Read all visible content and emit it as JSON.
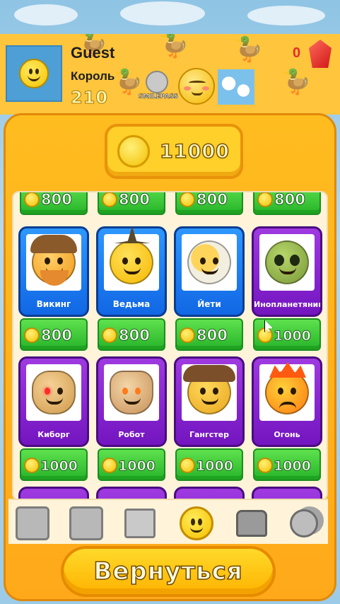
{
  "header": {
    "player_name": "Guest",
    "player_rank": "Король",
    "player_score": "210",
    "gems": "0",
    "smilepass_label": "SMILEPASS"
  },
  "shop": {
    "balance": "11000",
    "top_partial_prices": [
      "800",
      "800",
      "800",
      "800"
    ],
    "items": [
      {
        "name": "Викинг",
        "price": "800",
        "rarity": "blue",
        "icon": "viking-emoji"
      },
      {
        "name": "Ведьма",
        "price": "800",
        "rarity": "blue",
        "icon": "witch-emoji"
      },
      {
        "name": "Йети",
        "price": "800",
        "rarity": "blue",
        "icon": "yeti-emoji"
      },
      {
        "name": "Инопланетянин",
        "price": "1000",
        "rarity": "purple",
        "icon": "alien-emoji"
      },
      {
        "name": "Киборг",
        "price": "1000",
        "rarity": "purple",
        "icon": "cyborg-emoji"
      },
      {
        "name": "Робот",
        "price": "1000",
        "rarity": "purple",
        "icon": "robot-emoji"
      },
      {
        "name": "Гангстер",
        "price": "1000",
        "rarity": "purple",
        "icon": "gangster-emoji"
      },
      {
        "name": "Огонь",
        "price": "1000",
        "rarity": "purple",
        "icon": "fire-emoji"
      }
    ]
  },
  "tabs": [
    {
      "icon": "ticket-icon",
      "active": false
    },
    {
      "icon": "profile-icon",
      "active": false
    },
    {
      "icon": "picture-icon",
      "active": false
    },
    {
      "icon": "smile-icon",
      "active": true
    },
    {
      "icon": "chest-icon",
      "active": false
    },
    {
      "icon": "coins-icon",
      "active": false
    }
  ],
  "footer": {
    "back_label": "Вернуться"
  },
  "colors": {
    "panel": "#ffa91a",
    "card_blue": "#1167e4",
    "card_purple": "#7315c0",
    "price_green": "#27b42a"
  }
}
